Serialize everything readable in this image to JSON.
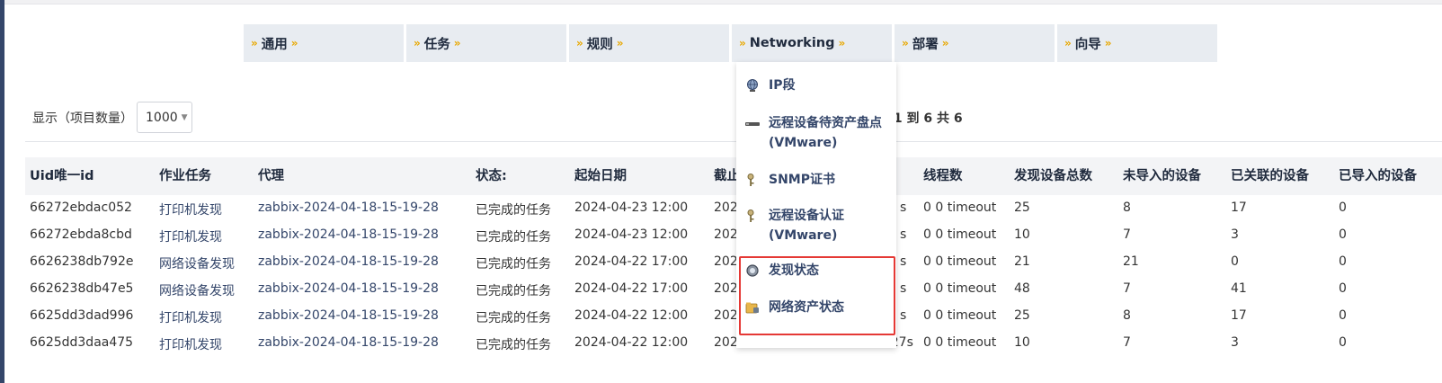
{
  "menu": {
    "items": [
      {
        "label": "通用"
      },
      {
        "label": "任务"
      },
      {
        "label": "规则"
      },
      {
        "label": "Networking"
      },
      {
        "label": "部署"
      },
      {
        "label": "向导"
      }
    ],
    "arrow": "»"
  },
  "dropdown": {
    "items": [
      {
        "label": "IP段",
        "icon": "globe-icon"
      },
      {
        "label": "远程设备待资产盘点 (VMware)",
        "icon": "server-icon"
      },
      {
        "label": "SNMP证书",
        "icon": "key-icon"
      },
      {
        "label": "远程设备认证 (VMware)",
        "icon": "key-icon"
      },
      {
        "label": "发现状态",
        "icon": "magnifier-icon"
      },
      {
        "label": "网络资产状态",
        "icon": "folder-lock-icon"
      }
    ]
  },
  "length": {
    "label": "显示（项目数量）",
    "value": "1000"
  },
  "info": "第 1 到 6 共 6",
  "table": {
    "headers": [
      "Uid唯一id",
      "作业任务",
      "代理",
      "状态:",
      "起始日期",
      "截止",
      "线程数",
      "发现设备总数",
      "未导入的设备",
      "已关联的设备",
      "已导入的设备"
    ],
    "rows": [
      [
        "66272ebdac052",
        "打印机发现",
        "zabbix-2024-04-18-15-19-28",
        "已完成的任务",
        "2024-04-23 12:00",
        "202",
        "s",
        "0 0 timeout",
        "25",
        "8",
        "17",
        "0"
      ],
      [
        "66272ebda8cbd",
        "打印机发现",
        "zabbix-2024-04-18-15-19-28",
        "已完成的任务",
        "2024-04-23 12:00",
        "202",
        "s",
        "0 0 timeout",
        "10",
        "7",
        "3",
        "0"
      ],
      [
        "6626238db792e",
        "网络设备发现",
        "zabbix-2024-04-18-15-19-28",
        "已完成的任务",
        "2024-04-22 17:00",
        "202",
        "s",
        "0 0 timeout",
        "21",
        "21",
        "0",
        "0"
      ],
      [
        "6626238db47e5",
        "网络设备发现",
        "zabbix-2024-04-18-15-19-28",
        "已完成的任务",
        "2024-04-22 17:00",
        "202",
        "s",
        "0 0 timeout",
        "48",
        "7",
        "41",
        "0"
      ],
      [
        "6625dd3dad996",
        "打印机发现",
        "zabbix-2024-04-18-15-19-28",
        "已完成的任务",
        "2024-04-22 12:00",
        "202",
        "s",
        "0 0 timeout",
        "25",
        "8",
        "17",
        "0"
      ],
      [
        "6625dd3daa475",
        "打印机发现",
        "zabbix-2024-04-18-15-19-28",
        "已完成的任务",
        "2024-04-22 12:00",
        "2024-04-22 12:01",
        "1min 27s",
        "0 0 timeout",
        "10",
        "7",
        "3",
        "0"
      ]
    ]
  },
  "colors": {
    "accent": "#34466a",
    "arrow": "#e8a800",
    "highlight": "#e53935",
    "menu_bg": "#e8ecf1"
  }
}
